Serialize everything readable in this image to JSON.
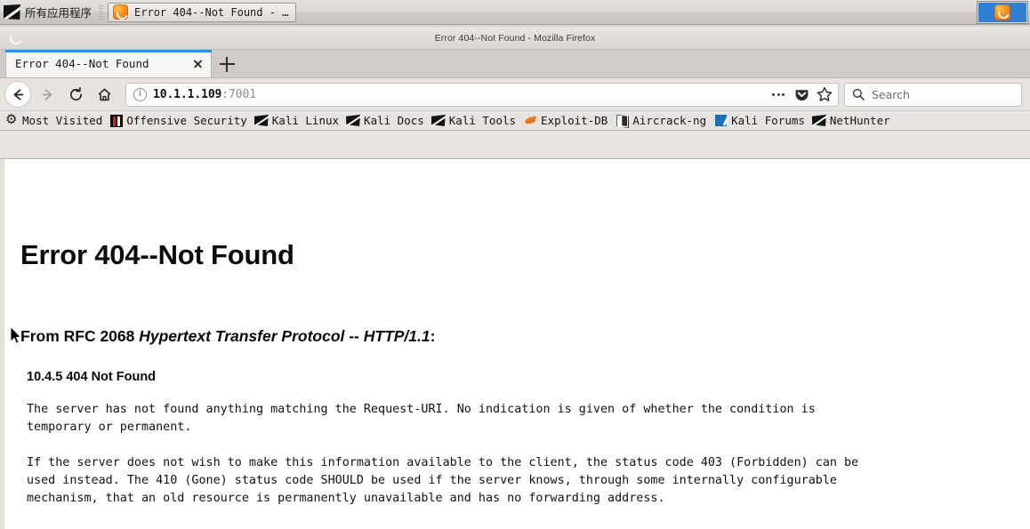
{
  "taskbar": {
    "launcher_label": "所有应用程序",
    "launcher_icon": "kali-dragon-icon",
    "window_button_label": "Error 404--Not Found - …",
    "window_button_icon": "firefox-icon",
    "pager_icon": "firefox-icon"
  },
  "window": {
    "title": "Error 404--Not Found - Mozilla Firefox",
    "icon": "firefox-icon"
  },
  "tabs": [
    {
      "title": "Error 404--Not Found",
      "close_icon": "close-icon",
      "active": true
    }
  ],
  "newtab": {
    "icon": "plus-icon"
  },
  "toolbar": {
    "back_icon": "arrow-left-icon",
    "forward_icon": "arrow-right-icon",
    "reload_icon": "reload-icon",
    "home_icon": "home-icon",
    "page_actions_icon": "ellipsis-icon",
    "pocket_icon": "pocket-shield-icon",
    "bookmark_icon": "star-icon"
  },
  "urlbar": {
    "identity_icon": "info-circle-icon",
    "host": "10.1.1.109",
    "rest": ":7001",
    "full_value": "10.1.1.109:7001"
  },
  "search": {
    "icon": "search-icon",
    "placeholder": "Search",
    "value": ""
  },
  "bookmarks": [
    {
      "label": "Most Visited",
      "icon": "gear-icon"
    },
    {
      "label": "Offensive Security",
      "icon": "offensive-security-icon"
    },
    {
      "label": "Kali Linux",
      "icon": "kali-sword-icon"
    },
    {
      "label": "Kali Docs",
      "icon": "kali-sword-icon"
    },
    {
      "label": "Kali Tools",
      "icon": "kali-sword-icon"
    },
    {
      "label": "Exploit-DB",
      "icon": "exploit-db-icon"
    },
    {
      "label": "Aircrack-ng",
      "icon": "aircrack-ng-icon"
    },
    {
      "label": "Kali Forums",
      "icon": "kali-forums-icon"
    },
    {
      "label": "NetHunter",
      "icon": "kali-sword-icon"
    }
  ],
  "page": {
    "heading": "Error 404--Not Found",
    "rfc_prefix": "From RFC 2068 ",
    "rfc_italic": "Hypertext Transfer Protocol -- HTTP/1.1",
    "rfc_suffix": ":",
    "section_heading": "10.4.5 404 Not Found",
    "paragraph1": "The server has not found anything matching the Request-URI. No indication is given of whether the condition is\ntemporary or permanent.",
    "paragraph2": "If the server does not wish to make this information available to the client, the status code 403 (Forbidden) can be\nused instead. The 410 (Gone) status code SHOULD be used if the server knows, through some internally configurable\nmechanism, that an old resource is permanently unavailable and has no forwarding address."
  },
  "colors": {
    "tab_accent": "#2196f3",
    "pager_blue": "#2f7fd6",
    "firefox_orange": "#f79420",
    "chrome_grey": "#e7e3df",
    "page_bg": "#ffffff"
  },
  "cursor": {
    "icon": "mouse-pointer-icon"
  }
}
